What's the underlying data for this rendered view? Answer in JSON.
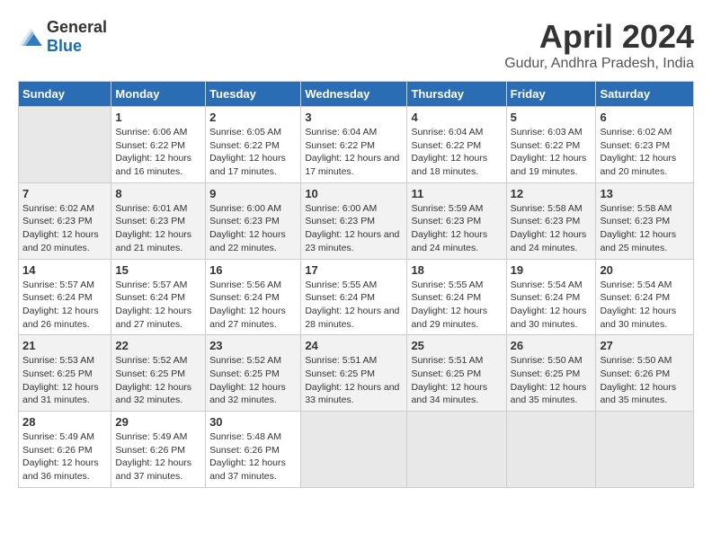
{
  "header": {
    "logo_general": "General",
    "logo_blue": "Blue",
    "month_title": "April 2024",
    "location": "Gudur, Andhra Pradesh, India"
  },
  "columns": [
    "Sunday",
    "Monday",
    "Tuesday",
    "Wednesday",
    "Thursday",
    "Friday",
    "Saturday"
  ],
  "weeks": [
    [
      {
        "day": "",
        "sunrise": "",
        "sunset": "",
        "daylight": ""
      },
      {
        "day": "1",
        "sunrise": "Sunrise: 6:06 AM",
        "sunset": "Sunset: 6:22 PM",
        "daylight": "Daylight: 12 hours and 16 minutes."
      },
      {
        "day": "2",
        "sunrise": "Sunrise: 6:05 AM",
        "sunset": "Sunset: 6:22 PM",
        "daylight": "Daylight: 12 hours and 17 minutes."
      },
      {
        "day": "3",
        "sunrise": "Sunrise: 6:04 AM",
        "sunset": "Sunset: 6:22 PM",
        "daylight": "Daylight: 12 hours and 17 minutes."
      },
      {
        "day": "4",
        "sunrise": "Sunrise: 6:04 AM",
        "sunset": "Sunset: 6:22 PM",
        "daylight": "Daylight: 12 hours and 18 minutes."
      },
      {
        "day": "5",
        "sunrise": "Sunrise: 6:03 AM",
        "sunset": "Sunset: 6:22 PM",
        "daylight": "Daylight: 12 hours and 19 minutes."
      },
      {
        "day": "6",
        "sunrise": "Sunrise: 6:02 AM",
        "sunset": "Sunset: 6:23 PM",
        "daylight": "Daylight: 12 hours and 20 minutes."
      }
    ],
    [
      {
        "day": "7",
        "sunrise": "Sunrise: 6:02 AM",
        "sunset": "Sunset: 6:23 PM",
        "daylight": "Daylight: 12 hours and 20 minutes."
      },
      {
        "day": "8",
        "sunrise": "Sunrise: 6:01 AM",
        "sunset": "Sunset: 6:23 PM",
        "daylight": "Daylight: 12 hours and 21 minutes."
      },
      {
        "day": "9",
        "sunrise": "Sunrise: 6:00 AM",
        "sunset": "Sunset: 6:23 PM",
        "daylight": "Daylight: 12 hours and 22 minutes."
      },
      {
        "day": "10",
        "sunrise": "Sunrise: 6:00 AM",
        "sunset": "Sunset: 6:23 PM",
        "daylight": "Daylight: 12 hours and 23 minutes."
      },
      {
        "day": "11",
        "sunrise": "Sunrise: 5:59 AM",
        "sunset": "Sunset: 6:23 PM",
        "daylight": "Daylight: 12 hours and 24 minutes."
      },
      {
        "day": "12",
        "sunrise": "Sunrise: 5:58 AM",
        "sunset": "Sunset: 6:23 PM",
        "daylight": "Daylight: 12 hours and 24 minutes."
      },
      {
        "day": "13",
        "sunrise": "Sunrise: 5:58 AM",
        "sunset": "Sunset: 6:23 PM",
        "daylight": "Daylight: 12 hours and 25 minutes."
      }
    ],
    [
      {
        "day": "14",
        "sunrise": "Sunrise: 5:57 AM",
        "sunset": "Sunset: 6:24 PM",
        "daylight": "Daylight: 12 hours and 26 minutes."
      },
      {
        "day": "15",
        "sunrise": "Sunrise: 5:57 AM",
        "sunset": "Sunset: 6:24 PM",
        "daylight": "Daylight: 12 hours and 27 minutes."
      },
      {
        "day": "16",
        "sunrise": "Sunrise: 5:56 AM",
        "sunset": "Sunset: 6:24 PM",
        "daylight": "Daylight: 12 hours and 27 minutes."
      },
      {
        "day": "17",
        "sunrise": "Sunrise: 5:55 AM",
        "sunset": "Sunset: 6:24 PM",
        "daylight": "Daylight: 12 hours and 28 minutes."
      },
      {
        "day": "18",
        "sunrise": "Sunrise: 5:55 AM",
        "sunset": "Sunset: 6:24 PM",
        "daylight": "Daylight: 12 hours and 29 minutes."
      },
      {
        "day": "19",
        "sunrise": "Sunrise: 5:54 AM",
        "sunset": "Sunset: 6:24 PM",
        "daylight": "Daylight: 12 hours and 30 minutes."
      },
      {
        "day": "20",
        "sunrise": "Sunrise: 5:54 AM",
        "sunset": "Sunset: 6:24 PM",
        "daylight": "Daylight: 12 hours and 30 minutes."
      }
    ],
    [
      {
        "day": "21",
        "sunrise": "Sunrise: 5:53 AM",
        "sunset": "Sunset: 6:25 PM",
        "daylight": "Daylight: 12 hours and 31 minutes."
      },
      {
        "day": "22",
        "sunrise": "Sunrise: 5:52 AM",
        "sunset": "Sunset: 6:25 PM",
        "daylight": "Daylight: 12 hours and 32 minutes."
      },
      {
        "day": "23",
        "sunrise": "Sunrise: 5:52 AM",
        "sunset": "Sunset: 6:25 PM",
        "daylight": "Daylight: 12 hours and 32 minutes."
      },
      {
        "day": "24",
        "sunrise": "Sunrise: 5:51 AM",
        "sunset": "Sunset: 6:25 PM",
        "daylight": "Daylight: 12 hours and 33 minutes."
      },
      {
        "day": "25",
        "sunrise": "Sunrise: 5:51 AM",
        "sunset": "Sunset: 6:25 PM",
        "daylight": "Daylight: 12 hours and 34 minutes."
      },
      {
        "day": "26",
        "sunrise": "Sunrise: 5:50 AM",
        "sunset": "Sunset: 6:25 PM",
        "daylight": "Daylight: 12 hours and 35 minutes."
      },
      {
        "day": "27",
        "sunrise": "Sunrise: 5:50 AM",
        "sunset": "Sunset: 6:26 PM",
        "daylight": "Daylight: 12 hours and 35 minutes."
      }
    ],
    [
      {
        "day": "28",
        "sunrise": "Sunrise: 5:49 AM",
        "sunset": "Sunset: 6:26 PM",
        "daylight": "Daylight: 12 hours and 36 minutes."
      },
      {
        "day": "29",
        "sunrise": "Sunrise: 5:49 AM",
        "sunset": "Sunset: 6:26 PM",
        "daylight": "Daylight: 12 hours and 37 minutes."
      },
      {
        "day": "30",
        "sunrise": "Sunrise: 5:48 AM",
        "sunset": "Sunset: 6:26 PM",
        "daylight": "Daylight: 12 hours and 37 minutes."
      },
      {
        "day": "",
        "sunrise": "",
        "sunset": "",
        "daylight": ""
      },
      {
        "day": "",
        "sunrise": "",
        "sunset": "",
        "daylight": ""
      },
      {
        "day": "",
        "sunrise": "",
        "sunset": "",
        "daylight": ""
      },
      {
        "day": "",
        "sunrise": "",
        "sunset": "",
        "daylight": ""
      }
    ]
  ]
}
